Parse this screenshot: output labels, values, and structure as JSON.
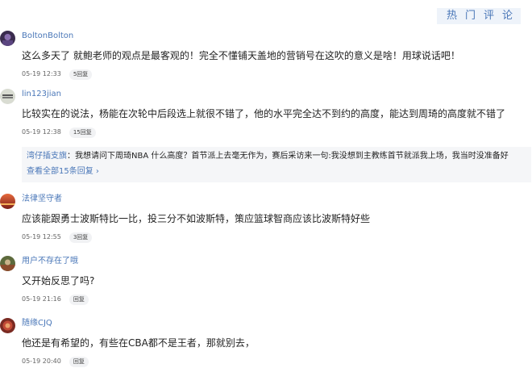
{
  "header": {
    "hot_tab_label": "热门评论"
  },
  "comments": [
    {
      "username": "BoltonBolton",
      "text": "这么多天了 就鲍老师的观点是最客观的！完全不懂铺天盖地的营销号在这吹的意义是啥！用球说话吧！",
      "time": "05-19 12:33",
      "reply_label": "5回复"
    },
    {
      "username": "lin123jian",
      "text": "比较实在的说法，杨能在次轮中后段选上就很不错了，他的水平完全达不到约的高度，能达到周琦的高度就不错了",
      "time": "05-19 12:38",
      "reply_label": "15回复",
      "replies": {
        "user": "湾仔插支旗",
        "text": "：我想请问下周琦NBA 什么高度？首节派上去毫无作为，赛后采访来一句:我没想到主教练首节就派我上场，我当时没准备好",
        "view_all_label": "查看全部15条回复 ›"
      }
    },
    {
      "username": "法律坚守者",
      "text": "应该能跟勇士波斯特比一比，投三分不如波斯特，策应篮球智商应该比波斯特好些",
      "time": "05-19 12:55",
      "reply_label": "3回复"
    },
    {
      "username": "用户不存在了哦",
      "text": "又开始反思了吗?",
      "time": "05-19 21:16",
      "reply_label": "回复"
    },
    {
      "username": "随缘CJQ",
      "text": "他还是有希望的，有些在CBA都不是王者，那就别去，",
      "time": "05-19 20:40",
      "reply_label": "回复"
    }
  ],
  "colors": {
    "link_blue": "#4a77b8",
    "text": "#222222",
    "reply_bg": "#f5f6f8",
    "tab_bg": "#eef3fa"
  }
}
